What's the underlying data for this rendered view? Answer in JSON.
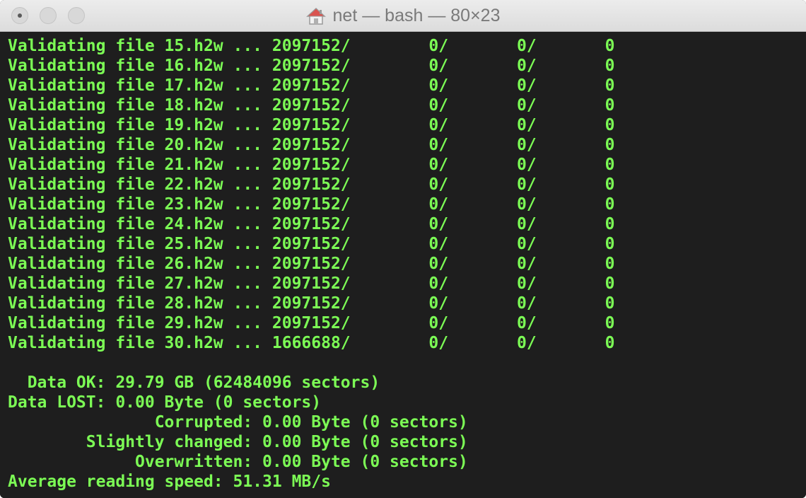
{
  "window": {
    "title": "net — bash — 80×23"
  },
  "terminal": {
    "lines": [
      "Validating file 15.h2w ... 2097152/        0/       0/       0",
      "Validating file 16.h2w ... 2097152/        0/       0/       0",
      "Validating file 17.h2w ... 2097152/        0/       0/       0",
      "Validating file 18.h2w ... 2097152/        0/       0/       0",
      "Validating file 19.h2w ... 2097152/        0/       0/       0",
      "Validating file 20.h2w ... 2097152/        0/       0/       0",
      "Validating file 21.h2w ... 2097152/        0/       0/       0",
      "Validating file 22.h2w ... 2097152/        0/       0/       0",
      "Validating file 23.h2w ... 2097152/        0/       0/       0",
      "Validating file 24.h2w ... 2097152/        0/       0/       0",
      "Validating file 25.h2w ... 2097152/        0/       0/       0",
      "Validating file 26.h2w ... 2097152/        0/       0/       0",
      "Validating file 27.h2w ... 2097152/        0/       0/       0",
      "Validating file 28.h2w ... 2097152/        0/       0/       0",
      "Validating file 29.h2w ... 2097152/        0/       0/       0",
      "Validating file 30.h2w ... 1666688/        0/       0/       0",
      "",
      "  Data OK: 29.79 GB (62484096 sectors)",
      "Data LOST: 0.00 Byte (0 sectors)",
      "               Corrupted: 0.00 Byte (0 sectors)",
      "        Slightly changed: 0.00 Byte (0 sectors)",
      "             Overwritten: 0.00 Byte (0 sectors)",
      "Average reading speed: 51.31 MB/s"
    ]
  },
  "colors": {
    "terminal_bg": "#1e1e1e",
    "terminal_fg": "#7cfc55",
    "titlebar_bg": "#e6e6e6",
    "title_text": "#7a7a7a"
  },
  "icons": {
    "title_icon": "home-icon"
  }
}
